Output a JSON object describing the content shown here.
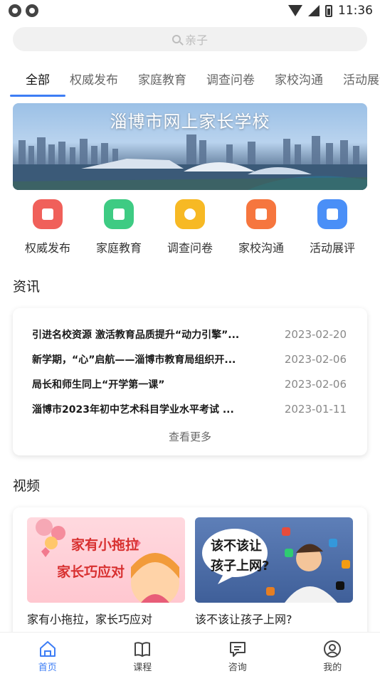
{
  "status_bar": {
    "time": "11:36"
  },
  "search": {
    "placeholder": "亲子"
  },
  "tabs": [
    {
      "label": "全部",
      "active": true
    },
    {
      "label": "权威发布"
    },
    {
      "label": "家庭教育"
    },
    {
      "label": "调查问卷"
    },
    {
      "label": "家校沟通"
    },
    {
      "label": "活动展评"
    }
  ],
  "banner": {
    "title": "淄博市网上家长学校"
  },
  "quick_links": [
    {
      "label": "权威发布",
      "color": "#f0605a",
      "icon": "badge-icon"
    },
    {
      "label": "家庭教育",
      "color": "#3ecb83",
      "icon": "house-icon"
    },
    {
      "label": "调查问卷",
      "color": "#f7b924",
      "icon": "pie-chart-icon"
    },
    {
      "label": "家校沟通",
      "color": "#f6763e",
      "icon": "message-icon"
    },
    {
      "label": "活动展评",
      "color": "#4a8ff7",
      "icon": "calendar-icon"
    }
  ],
  "news": {
    "section_title": "资讯",
    "items": [
      {
        "title": "引进名校资源 激活教育品质提升“动力引擎”...",
        "date": "2023-02-20"
      },
      {
        "title": "新学期，“心”启航——淄博市教育局组织开...",
        "date": "2023-02-06"
      },
      {
        "title": "局长和师生同上“开学第一课”",
        "date": "2023-02-06"
      },
      {
        "title": "淄博市2023年初中艺术科目学业水平考试 ...",
        "date": "2023-01-11"
      }
    ],
    "more_label": "查看更多"
  },
  "videos": {
    "section_title": "视频",
    "items": [
      {
        "title": "家有小拖拉，家长巧应对",
        "thumb_line1": "家有小拖拉",
        "thumb_line2": "家长巧应对"
      },
      {
        "title": "该不该让孩子上网?",
        "thumb_line1": "该不该让",
        "thumb_line2": "孩子上网?"
      }
    ]
  },
  "bottom_nav": [
    {
      "label": "首页",
      "icon": "home-icon",
      "active": true
    },
    {
      "label": "课程",
      "icon": "book-icon"
    },
    {
      "label": "咨询",
      "icon": "chat-icon"
    },
    {
      "label": "我的",
      "icon": "user-icon"
    }
  ],
  "accent_color": "#3d7df5"
}
